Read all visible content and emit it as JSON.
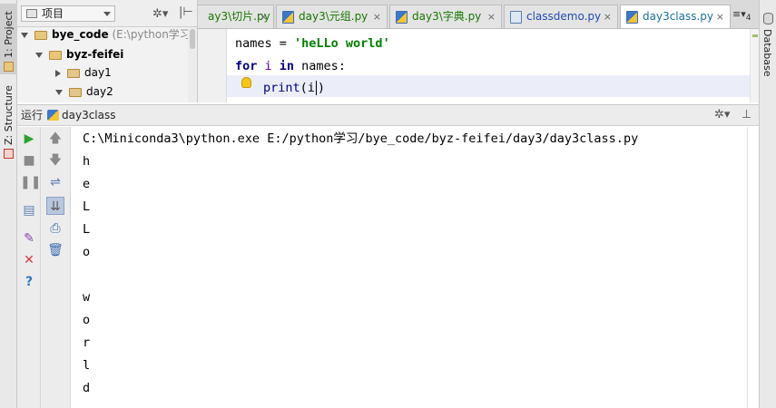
{
  "left_strip": {
    "project_tab": "1: Project",
    "structure_tab": "Z: Structure"
  },
  "right_strip": {
    "database_tab": "Database"
  },
  "project_panel": {
    "selector_label": "项目",
    "tree": [
      {
        "name": "bye_code",
        "path": "(E:\\python学习\\",
        "indent": 0,
        "expanded": true
      },
      {
        "name": "byz-feifei",
        "indent": 1,
        "expanded": true
      },
      {
        "name": "day1",
        "indent": 2,
        "expanded": false
      },
      {
        "name": "day2",
        "indent": 2,
        "expanded": false
      }
    ]
  },
  "editor_tabs": {
    "tabs": [
      {
        "label": "ay3\\切片.py",
        "style": "green",
        "active": false
      },
      {
        "label": "day3\\元组.py",
        "style": "green",
        "active": false
      },
      {
        "label": "day3\\字典.py",
        "style": "green",
        "active": false
      },
      {
        "label": "classdemo.py",
        "style": "blue",
        "active": false
      },
      {
        "label": "day3class.py",
        "style": "plain",
        "active": true
      }
    ],
    "more_count": "4"
  },
  "editor": {
    "line1": {
      "var": "names",
      "op": " = ",
      "str": "'heLLo world'"
    },
    "line2": {
      "kw1": "for",
      "var": " i ",
      "kw2": "in",
      "rest": " names:"
    },
    "line3": {
      "builtin": "print",
      "open": "(i",
      "close": ")"
    }
  },
  "run_panel": {
    "title": "运行",
    "config_name": "day3class",
    "command": "C:\\Miniconda3\\python.exe E:/python学习/bye_code/byz-feifei/day3/day3class.py",
    "output": [
      "h",
      "e",
      "L",
      "L",
      "o",
      " ",
      "w",
      "o",
      "r",
      "l",
      "d"
    ]
  },
  "colors": {
    "keyword": "#000080",
    "string": "#008000",
    "run_green": "#2ea12e",
    "stop_red": "#d93b3b"
  }
}
